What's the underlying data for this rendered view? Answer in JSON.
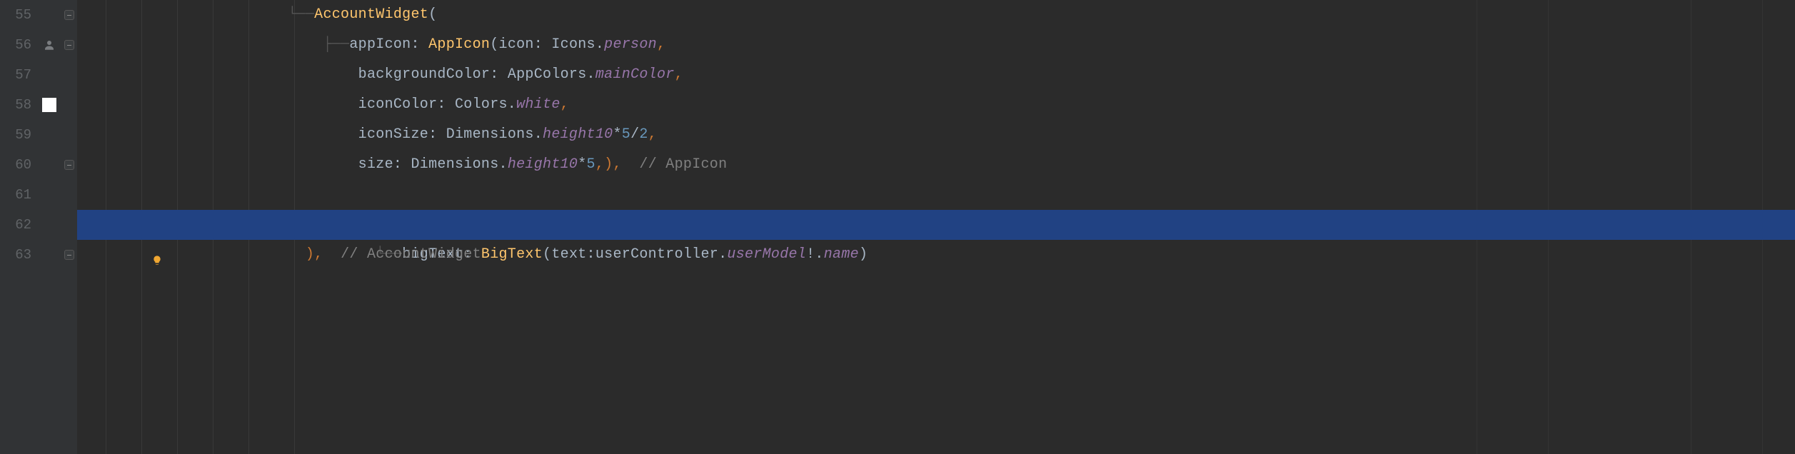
{
  "line_numbers": [
    "55",
    "56",
    "57",
    "58",
    "59",
    "60",
    "61",
    "62",
    "63"
  ],
  "code": {
    "l55": {
      "indent": "            ",
      "class1": "AccountWidget",
      "paren": "("
    },
    "l56": {
      "indent": "                ",
      "param": "appIcon: ",
      "class1": "AppIcon",
      "paren": "(",
      "param2": "icon: ",
      "ident": "Icons.",
      "prop": "person",
      "comma": ","
    },
    "l57": {
      "indent": "                    ",
      "param": "backgroundColor: ",
      "ident": "AppColors.",
      "prop": "mainColor",
      "comma": ","
    },
    "l58": {
      "indent": "                    ",
      "param": "iconColor: ",
      "ident": "Colors.",
      "prop": "white",
      "comma": ","
    },
    "l59": {
      "indent": "                    ",
      "param": "iconSize: ",
      "ident": "Dimensions.",
      "prop": "height10",
      "op1": "*",
      "num1": "5",
      "op2": "/",
      "num2": "2",
      "comma": ","
    },
    "l60": {
      "indent": "                    ",
      "param": "size: ",
      "ident": "Dimensions.",
      "prop": "height10",
      "op1": "*",
      "num1": "5",
      "comma": ",)",
      "comma2": ",",
      "sp": "  ",
      "comment": "// AppIcon"
    },
    "l61": {},
    "l62": {
      "indent": "                ",
      "param": "bigText: ",
      "class1": "BigText",
      "paren": "(",
      "param2": "text:",
      "ident": "userController.",
      "prop": "userModel",
      "excl": "!",
      "dot": ".",
      "prop2": "name",
      "close": ")"
    },
    "l63": {
      "indent": "            ",
      "close": "),",
      "sp": "  ",
      "comment": "// AccountWidget"
    }
  }
}
